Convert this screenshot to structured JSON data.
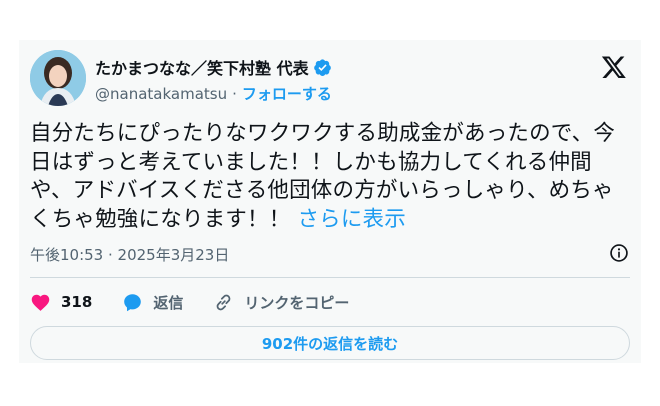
{
  "user": {
    "display_name": "たかまつなな／笑下村塾 代表",
    "handle": "@nanatakamatsu",
    "separator": "·",
    "follow_label": "フォローする"
  },
  "tweet": {
    "text": "自分たちにぴったりなワクワクする助成金があったので、今日はずっと考えていました！！しかも協力してくれる仲間や、アドバイスくださる他団体の方がいらっしゃり、めちゃくちゃ勉強になります！！",
    "show_more_label": "さらに表示",
    "timestamp": "午後10:53 · 2025年3月23日"
  },
  "actions": {
    "like_count": "318",
    "reply_label": "返信",
    "copy_link_label": "リンクをコピー"
  },
  "replies_button_label": "902件の返信を読む",
  "colors": {
    "accent": "#1d9bf0",
    "like": "#f91880",
    "muted": "#536471",
    "text": "#0f1419"
  }
}
